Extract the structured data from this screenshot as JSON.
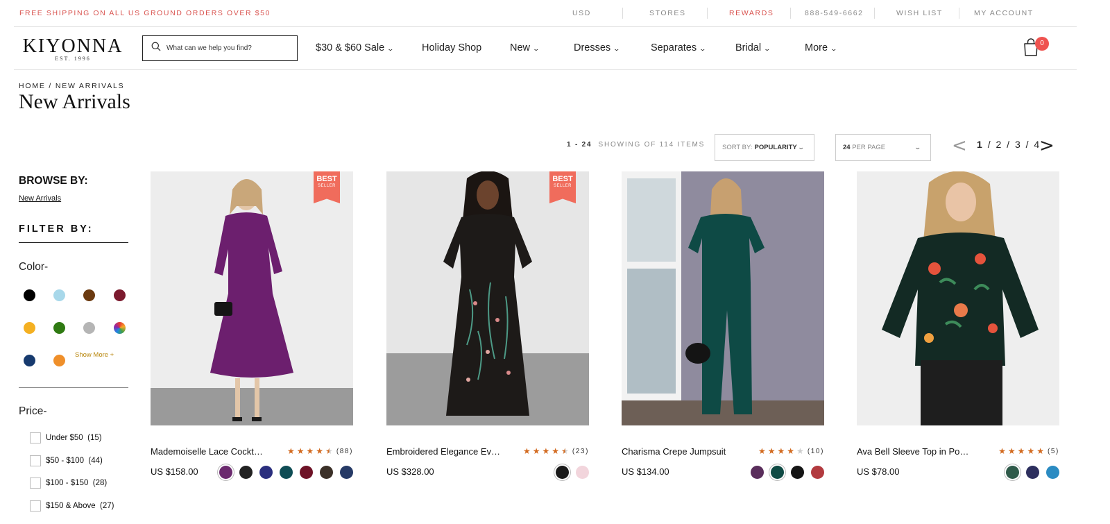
{
  "promo": "FREE SHIPPING ON ALL US GROUND ORDERS OVER $50",
  "utility_links": [
    "USD",
    "STORES",
    "REWARDS",
    "888-549-6662",
    "WISH LIST",
    "MY ACCOUNT"
  ],
  "logo": {
    "name": "KIYONNA",
    "est": "EST. 1996"
  },
  "search": {
    "placeholder": "What can we help you find?"
  },
  "nav": [
    "$30 & $60 Sale",
    "Holiday Shop",
    "New",
    "Dresses",
    "Separates",
    "Bridal",
    "More"
  ],
  "cart": {
    "count": "0"
  },
  "breadcrumb": "HOME / NEW ARRIVALS",
  "page_title": "New Arrivals",
  "listing": {
    "range": "1 - 24",
    "showing_text": "SHOWING OF 114 ITEMS",
    "sort_label": "SORT BY:",
    "sort_value": "POPULARITY",
    "per_page_value": "24",
    "per_page_label": "PER PAGE",
    "pages": [
      "1",
      "2",
      "3",
      "4"
    ]
  },
  "sidebar": {
    "browse_by": "BROWSE BY:",
    "browse_link": "New Arrivals",
    "filter_by": "FILTER BY:",
    "color_title": "Color-",
    "colors": [
      "#000000",
      "#a8d8ea",
      "#6b3a10",
      "#7b1a2e",
      "#f4b022",
      "#2f7a12",
      "#b5b5b5",
      "multicolor",
      "#173a6e",
      "#ef8f2a"
    ],
    "show_more": "Show More +",
    "price_title": "Price-",
    "prices": [
      {
        "label": "Under $50",
        "count": "(15)"
      },
      {
        "label": "$50 - $100",
        "count": "(44)"
      },
      {
        "label": "$100 - $150",
        "count": "(28)"
      },
      {
        "label": "$150 & Above",
        "count": "(27)"
      }
    ]
  },
  "badge": {
    "line1": "BEST",
    "line2": "SELLER"
  },
  "products": [
    {
      "name": "Mademoiselle Lace Cocktail Dress",
      "price": "US $158.00",
      "rating": 4.5,
      "reviews": "(88)",
      "best_seller": true,
      "swatches": [
        "#6b2a6e",
        "#222222",
        "#2b2f7e",
        "#0f4d55",
        "#6e1327",
        "#3b3028",
        "#263a66"
      ]
    },
    {
      "name": "Embroidered Elegance Evening Gown",
      "price": "US $328.00",
      "rating": 4.5,
      "reviews": "(23)",
      "best_seller": true,
      "swatches": [
        "#1a1a1a",
        "#f2d5dc"
      ]
    },
    {
      "name": "Charisma Crepe Jumpsuit",
      "price": "US $134.00",
      "rating": 4,
      "reviews": "(10)",
      "best_seller": false,
      "swatches": [
        "#5a2e5c",
        "#0f4a44",
        "#151515",
        "#b23a3f"
      ]
    },
    {
      "name": "Ava Bell Sleeve Top in Poppy Print",
      "price": "US $78.00",
      "rating": 5,
      "reviews": "(5)",
      "best_seller": false,
      "swatches": [
        "#2f5a4a",
        "#2d2f5e",
        "#2b8bc2"
      ]
    }
  ]
}
